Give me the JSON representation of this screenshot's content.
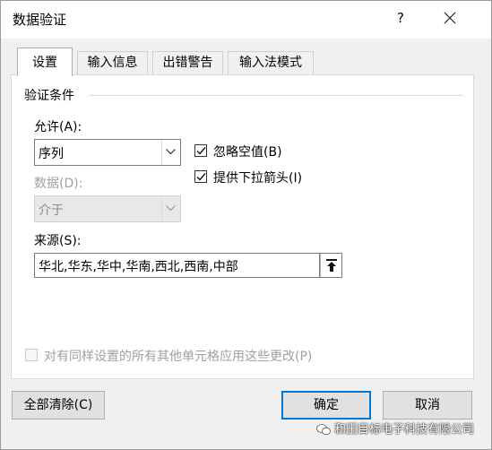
{
  "window": {
    "title": "数据验证",
    "help_label": "?"
  },
  "tabs": [
    {
      "label": "设置",
      "active": true
    },
    {
      "label": "输入信息",
      "active": false
    },
    {
      "label": "出错警告",
      "active": false
    },
    {
      "label": "输入法模式",
      "active": false
    }
  ],
  "settings": {
    "group_label": "验证条件",
    "allow_label": "允许(A):",
    "allow_value": "序列",
    "data_label": "数据(D):",
    "data_value": "介于",
    "ignore_blank_label": "忽略空值(B)",
    "ignore_blank_checked": true,
    "dropdown_label": "提供下拉箭头(I)",
    "dropdown_checked": true,
    "source_label": "来源(S):",
    "source_value": "华北,华东,华中,华南,西北,西南,中部",
    "apply_all_label": "对有同样设置的所有其他单元格应用这些更改(P)",
    "apply_all_checked": false
  },
  "buttons": {
    "clear_all": "全部清除(C)",
    "ok": "确定",
    "cancel": "取消"
  },
  "watermark": {
    "text": "和田目标电子科技有限公司"
  },
  "colors": {
    "default_button_border": "#0078d7",
    "dialog_background": "#f0f0f0"
  }
}
